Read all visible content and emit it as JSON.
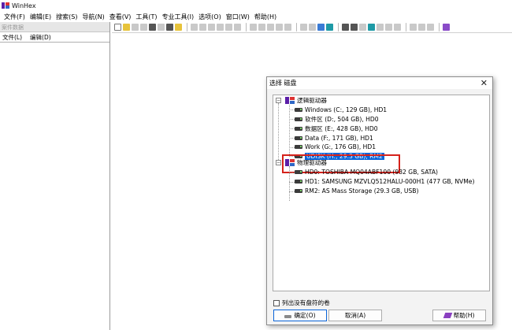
{
  "window": {
    "title": "WinHex"
  },
  "menu": [
    "文件(F)",
    "编辑(E)",
    "搜索(S)",
    "导航(N)",
    "查看(V)",
    "工具(T)",
    "专业工具(I)",
    "选项(O)",
    "窗口(W)",
    "帮助(H)"
  ],
  "left_panel": {
    "header": "案件数据",
    "menu": [
      "文件(L)",
      "编辑(D)"
    ]
  },
  "dialog": {
    "title": "选择 磁盘",
    "close": "✕",
    "logical_group": "逻辑驱动器",
    "logical_drives": [
      "Windows (C:, 129 GB), HD1",
      "软件区 (D:, 504 GB), HD0",
      "数据区 (E:, 428 GB), HD0",
      "Data (F:, 171 GB), HD1",
      "Work (G:, 176 GB), HD1",
      "UDISK (H:, 29.3 GB), RM2"
    ],
    "selected_index": 5,
    "physical_group": "物理驱动器",
    "physical_drives": [
      "HD0: TOSHIBA MQ04ABF100 (932 GB, SATA)",
      "HD1: SAMSUNG MZVLQ512HALU-000H1 (477 GB, NVMe)",
      "RM2: AS Mass Storage (29.3 GB, USB)"
    ],
    "expander_symbol": "−",
    "checkbox_label": "列出没有盘符的卷",
    "ok_label": "确定(O)",
    "cancel_label": "取消(A)",
    "help_label": "帮助(H)"
  }
}
